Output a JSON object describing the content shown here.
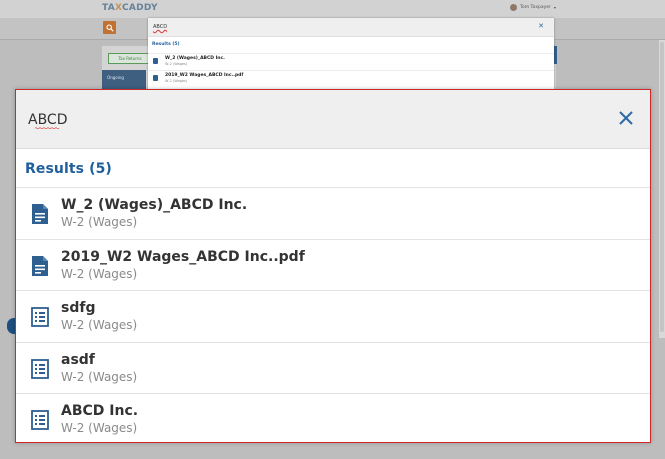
{
  "app": {
    "logo_prefix": "TA",
    "logo_x": "X",
    "logo_suffix": "CADDY",
    "user_name": "Tom Taxpayer",
    "tax_returns_label": "Tax Returns",
    "nav_label": "Ongoing"
  },
  "search": {
    "query": "ABCD",
    "results_label": "Results (5)",
    "close_icon": "close-icon",
    "results": [
      {
        "title": "W_2 (Wages)_ABCD Inc.",
        "subtitle": "W-2 (Wages)",
        "icon": "document-icon"
      },
      {
        "title": "2019_W2 Wages_ABCD Inc..pdf",
        "subtitle": "W-2 (Wages)",
        "icon": "document-icon"
      },
      {
        "title": "sdfg",
        "subtitle": "W-2 (Wages)",
        "icon": "list-form-icon"
      },
      {
        "title": "asdf",
        "subtitle": "W-2 (Wages)",
        "icon": "list-form-icon"
      },
      {
        "title": "ABCD Inc.",
        "subtitle": "W-2 (Wages)",
        "icon": "list-form-icon"
      }
    ]
  },
  "colors": {
    "accent_blue": "#1f5f9e",
    "icon_blue": "#2d5f90",
    "highlight_red": "#cc2a2a",
    "orange": "#c17131"
  }
}
